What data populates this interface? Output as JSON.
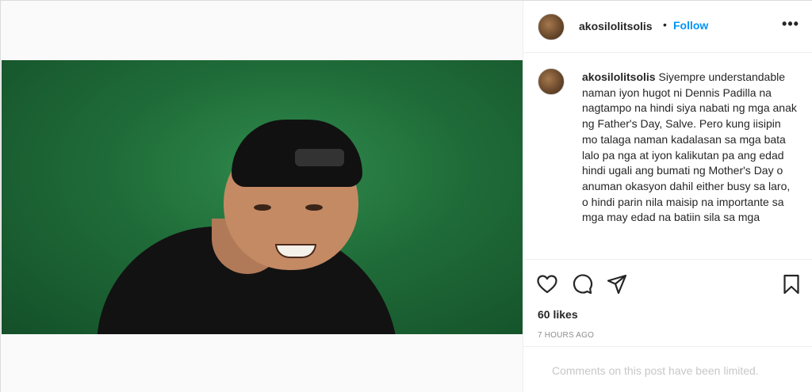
{
  "post": {
    "author": {
      "username": "akosilolitsolis",
      "follow_label": "Follow",
      "separator": "•"
    },
    "caption": {
      "username": "akosilolitsolis",
      "text": "Siyempre understandable naman iyon hugot ni Dennis Padilla na nagtampo na hindi siya nabati ng mga anak ng Father's Day, Salve. Pero kung iisipin mo talaga naman kadalasan sa mga bata lalo pa nga at iyon kalikutan pa ang edad hindi ugali ang bumati ng Mother's Day o anuman okasyon dahil either busy sa laro, o hindi parin nila maisip na importante sa mga may edad na batiin sila sa mga"
    },
    "likes": "60 likes",
    "timestamp": "7 HOURS AGO",
    "comments_notice": "Comments on this post have been limited.",
    "more_label": "•••"
  },
  "icons": {
    "like": "heart-icon",
    "comment": "comment-icon",
    "share": "share-icon",
    "save": "bookmark-icon",
    "more": "more-options-icon"
  },
  "colors": {
    "accent": "#0095f6",
    "text": "#262626",
    "muted": "#8e8e8e",
    "border": "#dbdbdb"
  }
}
